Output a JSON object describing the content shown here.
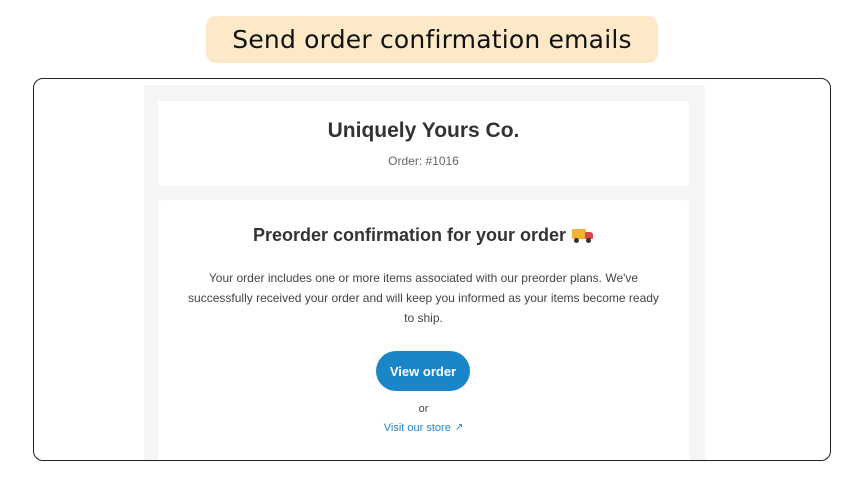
{
  "banner": {
    "title": "Send order confirmation emails"
  },
  "email": {
    "header": {
      "shop_name": "Uniquely Yours Co.",
      "order_number": "Order: #1016"
    },
    "main": {
      "heading": "Preorder confirmation for your order",
      "heading_icon": "delivery-truck-icon",
      "body": "Your order includes one or more items associated with our preorder plans. We've successfully received your order and will keep you informed as your items become ready to ship.",
      "view_order_label": "View order",
      "or_label": "or",
      "store_link_label": "Visit our store",
      "store_link_icon": "external-link-icon"
    }
  },
  "colors": {
    "banner_bg": "#fde9c8",
    "button_bg": "#1a86c8",
    "link": "#2b84c6",
    "email_bg": "#f5f5f7"
  }
}
